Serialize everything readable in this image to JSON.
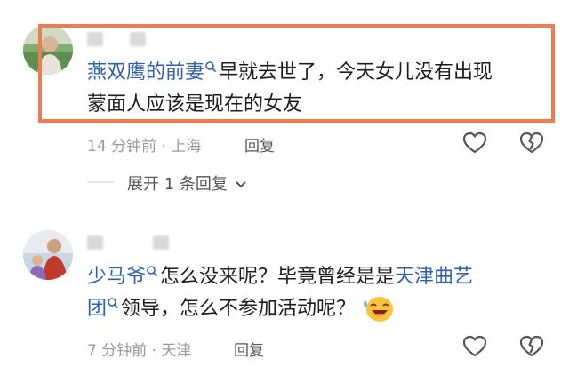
{
  "comments": [
    {
      "username": "燕双鹰的前妻",
      "text_line1": "早就去世了，今天女儿没有出现",
      "text_line2": "蒙面人应该是现在的女友",
      "time": "14 分钟前 · 上海",
      "reply_label": "回复",
      "expand_label": "展开 1 条回复"
    },
    {
      "username": "少马爷",
      "text_line1_a": "怎么没来呢？毕竟曾经是是",
      "link_a": "天津曲艺",
      "link_b": "团",
      "text_line2": "领导，怎么不参加活动呢？",
      "time": "7 分钟前 · 天津",
      "reply_label": "回复"
    }
  ],
  "colors": {
    "highlight": "#f07a52",
    "name": "#2f5fb3",
    "meta": "#9a9a9a"
  },
  "icons": [
    "magnifier-icon",
    "heart-icon",
    "broken-heart-icon",
    "chevron-down-icon",
    "laughing-emoji"
  ]
}
